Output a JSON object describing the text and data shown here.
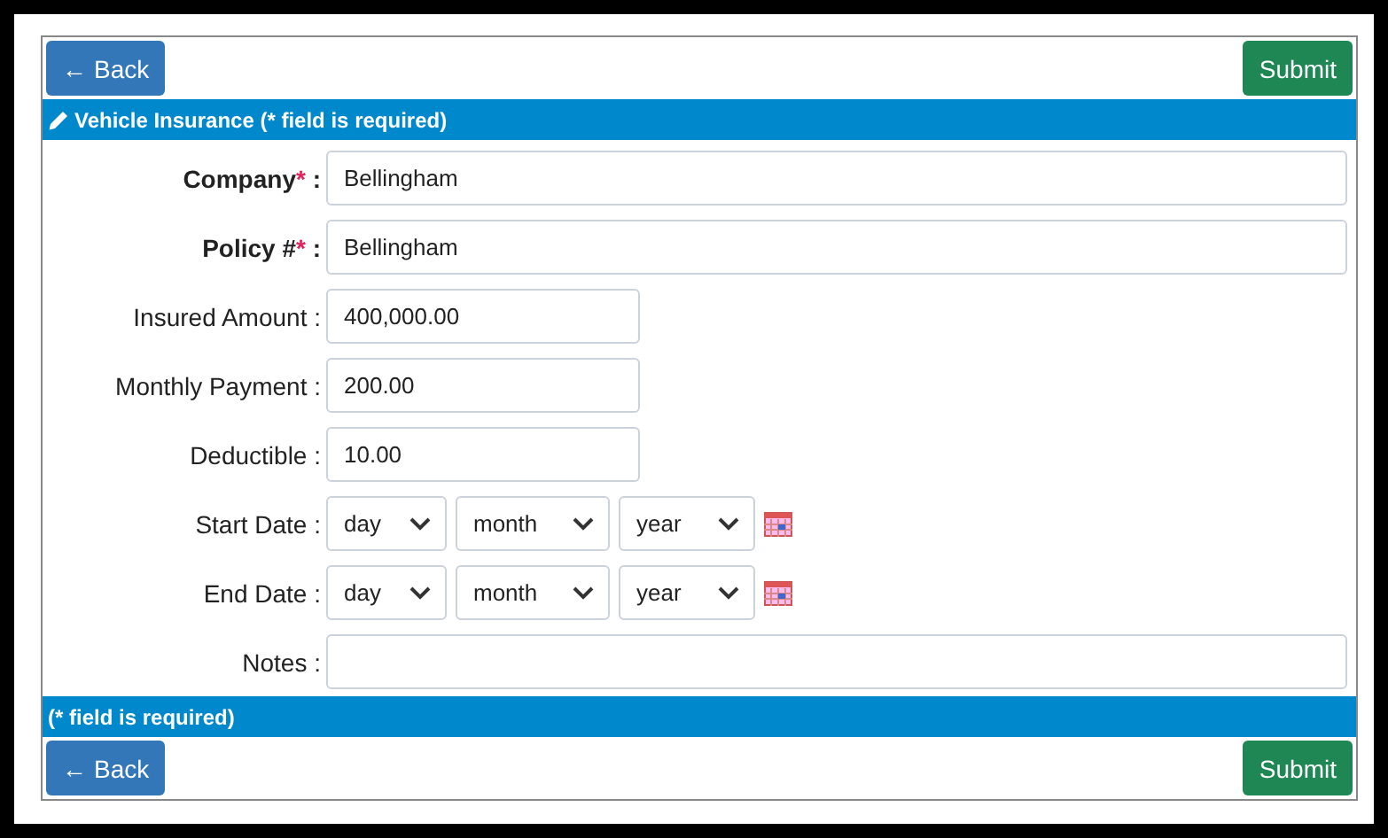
{
  "top_actions": {
    "back": {
      "arrow": "←",
      "label": "Back"
    },
    "submit": "Submit"
  },
  "header": {
    "title": "Vehicle Insurance (* field is required)"
  },
  "fields": [
    {
      "kind": "text",
      "label": "Company",
      "required": true,
      "asterisk": "*",
      "separator": ":",
      "wide": true,
      "value": "Bellingham"
    },
    {
      "kind": "text",
      "label": "Policy #",
      "required": true,
      "asterisk": "*",
      "separator": ":",
      "wide": true,
      "value": "Bellingham"
    },
    {
      "kind": "text",
      "label": "Insured Amount",
      "required": false,
      "separator": ":",
      "wide": false,
      "value": "400,000.00"
    },
    {
      "kind": "text",
      "label": "Monthly Payment",
      "required": false,
      "separator": ":",
      "wide": false,
      "value": "200.00"
    },
    {
      "kind": "text",
      "label": "Deductible",
      "required": false,
      "separator": ":",
      "wide": false,
      "value": "10.00"
    },
    {
      "kind": "date",
      "label": "Start Date",
      "required": false,
      "separator": ":",
      "selects": [
        "day",
        "month",
        "year"
      ]
    },
    {
      "kind": "date",
      "label": "End Date",
      "required": false,
      "separator": ":",
      "selects": [
        "day",
        "month",
        "year"
      ]
    },
    {
      "kind": "text",
      "label": "Notes",
      "required": false,
      "separator": ":",
      "wide": true
    }
  ],
  "footer": {
    "note": "(* field is required)"
  },
  "bottom_actions": {
    "back": {
      "arrow": "←",
      "label": "Back"
    },
    "submit": "Submit"
  }
}
